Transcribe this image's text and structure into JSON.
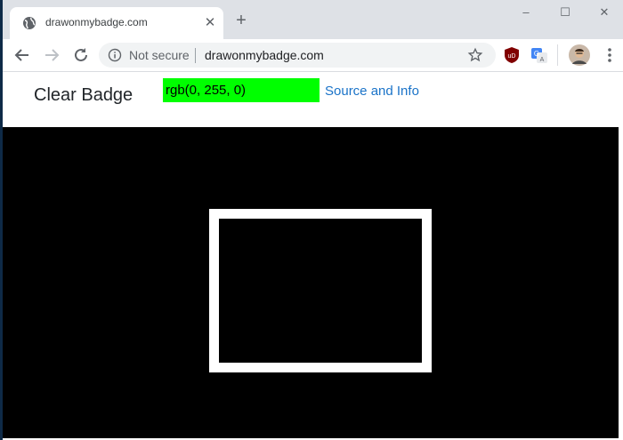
{
  "browser": {
    "tab_title": "drawonmybadge.com",
    "new_tab_symbol": "+",
    "close_tab_symbol": "✕",
    "security_label": "Not secure",
    "url": "drawonmybadge.com",
    "window_controls": {
      "minimize": "–",
      "maximize": "☐",
      "close": "✕"
    }
  },
  "page": {
    "clear_button_label": "Clear Badge",
    "color_value": "rgb(0, 255, 0)",
    "color_swatch": "#00ff00",
    "source_link_label": "Source and Info",
    "canvas_background": "#000000",
    "badge_outline_color": "#ffffff"
  }
}
